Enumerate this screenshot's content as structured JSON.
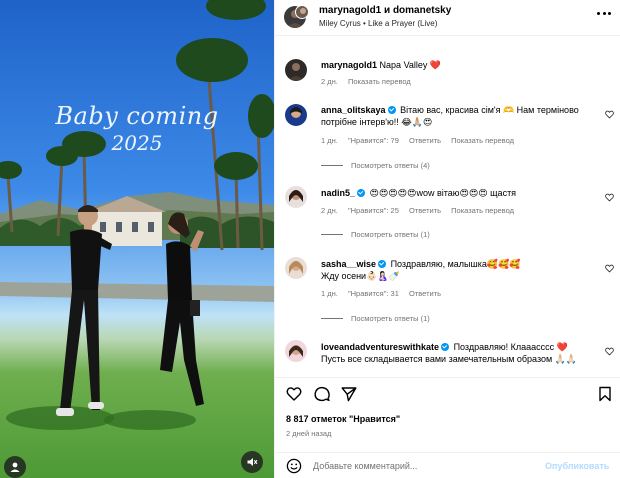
{
  "photo": {
    "overlay_title": "Baby coming",
    "overlay_year": "2025"
  },
  "header": {
    "title": "marynagold1 и domanetsky",
    "audio": "Miley Cyrus • Like a Prayer (Live)"
  },
  "caption": {
    "username": "marynagold1",
    "text": "Napa Valley ❤️",
    "time": "2 дн.",
    "translate": "Показать перевод"
  },
  "comments": [
    {
      "username": "anna_olitskaya",
      "verified": true,
      "text": "Вітаю вас, красива сім'я 🫶 Нам терміново потрібне інтерв'ю!! 😂🙏🏼😍",
      "time": "1 дн.",
      "likes": "\"Нравится\": 79",
      "reply": "Ответить",
      "translate": "Показать перевод",
      "replies": "Посмотреть ответы (4)"
    },
    {
      "username": "nadin5_",
      "verified": true,
      "text": "😍😍😍😍😍wow вітаю😍😍😍 щастя",
      "time": "2 дн.",
      "likes": "\"Нравится\": 25",
      "reply": "Ответить",
      "translate": "Показать перевод",
      "replies": "Посмотреть ответы (1)"
    },
    {
      "username": "sasha__wise",
      "verified": true,
      "text_line1": "Поздравляю, малышка🥰🥰🥰",
      "text_line2": "Жду осени👶🏻🤱🏻🍼",
      "time": "1 дн.",
      "likes": "\"Нравится\": 31",
      "reply": "Ответить",
      "replies": "Посмотреть ответы (1)"
    },
    {
      "username": "loveandadventureswithkate",
      "verified": true,
      "text": "Поздравляю! Клааасссс ❤️",
      "text_line2": "Пусть все складывается вами замечательным образом 🙏🏻🙏🏻"
    }
  ],
  "actions": {
    "likes": "8 817 отметок \"Нравится\"",
    "date": "2 дней назад"
  },
  "composer": {
    "placeholder": "Добавьте комментарий...",
    "post_label": "Опубликовать"
  },
  "colors": {
    "accent": "#0095f6",
    "post_disabled": "#b3dbff",
    "heart_red": "#e0245e",
    "muted_text": "#737373"
  }
}
